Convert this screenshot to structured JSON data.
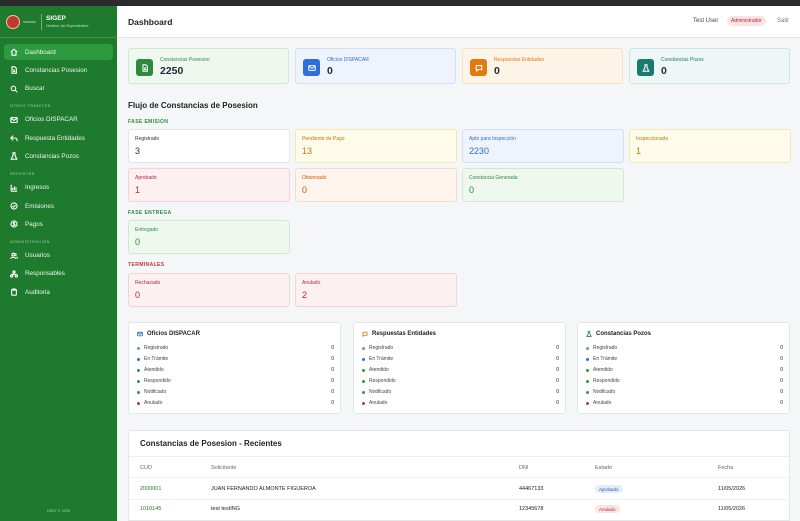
{
  "app": {
    "name": "SIGEP",
    "subtitle": "Gestion de Expedientes",
    "logo_text": "SISTEMA",
    "footer": "DRAT © 2026"
  },
  "sidebar": {
    "items_main": [
      {
        "label": "Dashboard",
        "icon": "home-icon"
      },
      {
        "label": "Constancias Posesion",
        "icon": "document-icon"
      },
      {
        "label": "Buscar",
        "icon": "search-icon"
      }
    ],
    "section_otros": "OTROS TRÁMITES",
    "items_otros": [
      {
        "label": "Oficios DISPACAR",
        "icon": "mail-icon"
      },
      {
        "label": "Respuesta Entidades",
        "icon": "reply-icon"
      },
      {
        "label": "Constancias Pozos",
        "icon": "flask-icon"
      }
    ],
    "section_reportes": "REPORTES",
    "items_reportes": [
      {
        "label": "Ingresos",
        "icon": "chart-icon"
      },
      {
        "label": "Emisiones",
        "icon": "check-circle-icon"
      },
      {
        "label": "Pagos",
        "icon": "dollar-icon"
      }
    ],
    "section_admin": "ADMINISTRACIÓN",
    "items_admin": [
      {
        "label": "Usuarios",
        "icon": "users-icon"
      },
      {
        "label": "Responsables",
        "icon": "hierarchy-icon"
      },
      {
        "label": "Auditoria",
        "icon": "clipboard-icon"
      }
    ]
  },
  "header": {
    "title": "Dashboard",
    "user": "Test User",
    "role": "Administrador",
    "logout": "Salir"
  },
  "stats": [
    {
      "label": "Constancias Posesion",
      "value": "2250",
      "color": "#2e8b3e"
    },
    {
      "label": "Oficios DISPACAR",
      "value": "0",
      "color": "#2f6fd8"
    },
    {
      "label": "Respuestas Entidades",
      "value": "0",
      "color": "#e07b12"
    },
    {
      "label": "Constancias Pozos",
      "value": "0",
      "color": "#1b7a6e"
    }
  ],
  "flujo": {
    "title": "Flujo de Constancias de Posesion",
    "fase_emision": "FASE EMISION",
    "fase_entrega": "FASE ENTREGA",
    "terminales": "TERMINALES",
    "emision": [
      {
        "label": "Registrado",
        "value": "3"
      },
      {
        "label": "Pendiente de Pago",
        "value": "13"
      },
      {
        "label": "Apto para Inspección",
        "value": "2230"
      },
      {
        "label": "Inspeccionado",
        "value": "1"
      },
      {
        "label": "Aprobado",
        "value": "1"
      },
      {
        "label": "Observado",
        "value": "0"
      },
      {
        "label": "Constancia Generada",
        "value": "0"
      }
    ],
    "entrega": [
      {
        "label": "Entregado",
        "value": "0"
      }
    ],
    "terminal": [
      {
        "label": "Rechazado",
        "value": "0"
      },
      {
        "label": "Anulado",
        "value": "2"
      }
    ]
  },
  "panels": [
    {
      "title": "Oficios DISPACAR",
      "rows": [
        {
          "label": "Registrado",
          "value": "0"
        },
        {
          "label": "En Trámite",
          "value": "0"
        },
        {
          "label": "Atendido",
          "value": "0"
        },
        {
          "label": "Respondido",
          "value": "0"
        },
        {
          "label": "Notificado",
          "value": "0"
        },
        {
          "label": "Anulado",
          "value": "0"
        }
      ]
    },
    {
      "title": "Respuestas Entidades",
      "rows": [
        {
          "label": "Registrado",
          "value": "0"
        },
        {
          "label": "En Trámite",
          "value": "0"
        },
        {
          "label": "Atendido",
          "value": "0"
        },
        {
          "label": "Respondido",
          "value": "0"
        },
        {
          "label": "Notificado",
          "value": "0"
        },
        {
          "label": "Anulado",
          "value": "0"
        }
      ]
    },
    {
      "title": "Constancias Pozos",
      "rows": [
        {
          "label": "Registrado",
          "value": "0"
        },
        {
          "label": "En Trámite",
          "value": "0"
        },
        {
          "label": "Atendido",
          "value": "0"
        },
        {
          "label": "Respondido",
          "value": "0"
        },
        {
          "label": "Notificado",
          "value": "0"
        },
        {
          "label": "Anulado",
          "value": "0"
        }
      ]
    }
  ],
  "status_colors": [
    "#8a8f96",
    "#2f6fd8",
    "#2e9a3f",
    "#2e9a3f",
    "#2e9a3f",
    "#c0392b"
  ],
  "recent": {
    "title": "Constancias de Posesion - Recientes",
    "columns": [
      "CUD",
      "Solicitante",
      "DNI",
      "Estado",
      "Fecha"
    ],
    "rows": [
      {
        "cud": "2000001",
        "solicitante": "JUAN FERNANDO ALMONTE FIGUEROA",
        "dni": "44467133",
        "estado": "Aprobado",
        "fecha": "11/05/2026"
      },
      {
        "cud": "1010145",
        "solicitante": "test testING",
        "dni": "12345678",
        "estado": "Anulado",
        "fecha": "11/05/2026"
      }
    ]
  }
}
